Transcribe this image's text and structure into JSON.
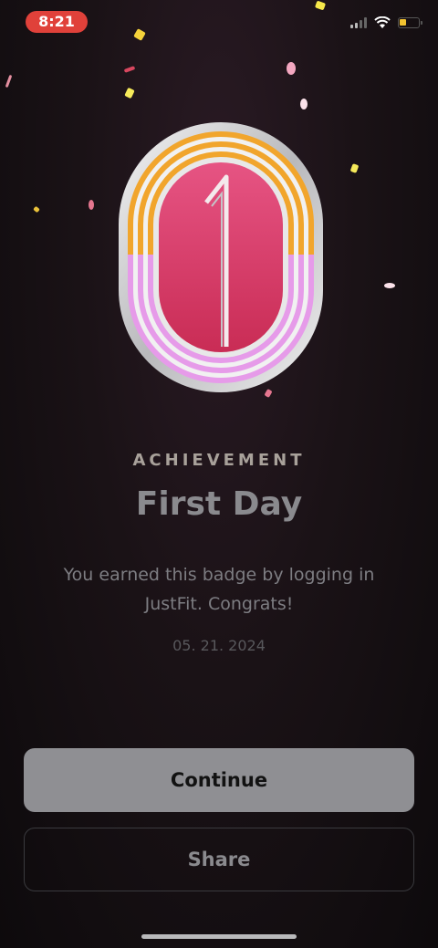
{
  "status_bar": {
    "time": "8:21",
    "icons": [
      "cellular-signal-icon",
      "wifi-icon",
      "battery-icon"
    ],
    "time_pill_color": "#e0413a",
    "battery_color": "#f2c230"
  },
  "badge": {
    "icon": "first-day-badge-icon",
    "numeral": "1",
    "colors": {
      "top_stripes": "#f0a32a",
      "bottom_stripes": "#e79be8",
      "center": "#d6365f"
    }
  },
  "achievement": {
    "eyebrow": "ACHIEVEMENT",
    "title": "First Day",
    "description": "You earned this badge by logging in JustFit. Congrats!",
    "date": "05. 21. 2024"
  },
  "actions": {
    "continue_label": "Continue",
    "share_label": "Share"
  }
}
